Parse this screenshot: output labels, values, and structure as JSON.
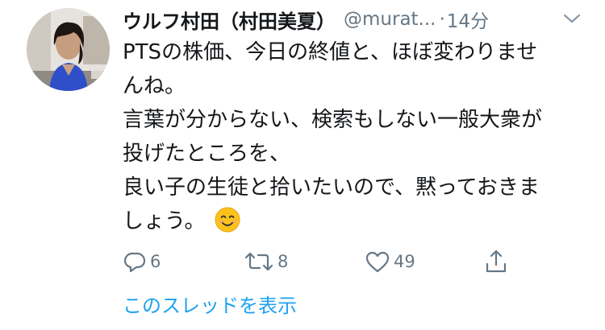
{
  "tweet": {
    "display_name": "ウルフ村田（村田美夏）",
    "handle": "@murat...",
    "separator": "·",
    "time": "14分",
    "text_lines": [
      "PTSの株価、今日の終値と、ほぼ変わりませ",
      "んね。",
      "言葉が分からない、検索もしない一般大衆が",
      "投げたところを、",
      "良い子の生徒と拾いたいので、黙っておきま",
      "しょう。"
    ],
    "emoji": "smiling-face-emoji",
    "actions": {
      "reply_count": "6",
      "retweet_count": "8",
      "like_count": "49"
    },
    "thread_link": "このスレッドを表示"
  },
  "colors": {
    "text_primary": "#14171a",
    "text_secondary": "#657786",
    "link": "#1da1f2",
    "background": "#ffffff"
  },
  "icons": [
    "chevron-down-icon",
    "reply-icon",
    "retweet-icon",
    "like-icon",
    "share-icon"
  ]
}
